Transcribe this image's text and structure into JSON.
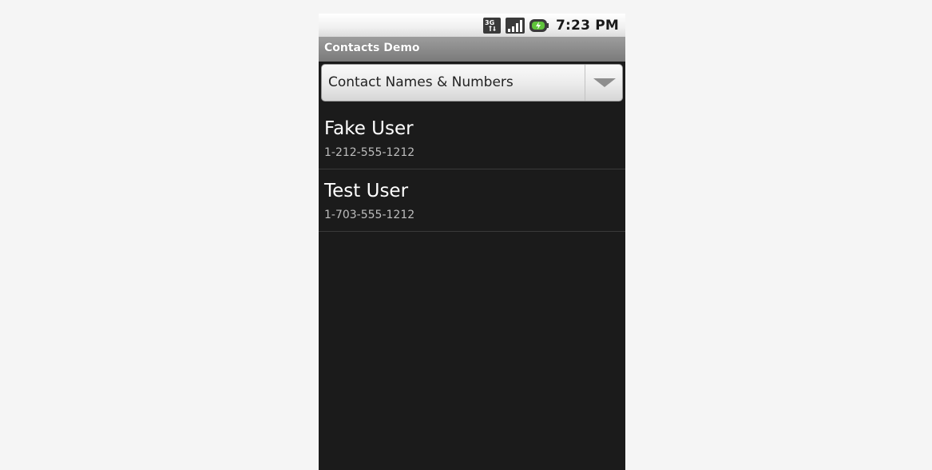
{
  "status_bar": {
    "network_icon": "3g-data-icon",
    "signal_icon": "signal-strength-icon",
    "battery_icon": "battery-charging-icon",
    "time": "7:23 PM"
  },
  "title_bar": {
    "title": "Contacts Demo"
  },
  "spinner": {
    "selected": "Contact Names & Numbers",
    "arrow_icon": "dropdown-arrow-icon"
  },
  "contacts": [
    {
      "name": "Fake User",
      "number": "1-212-555-1212"
    },
    {
      "name": "Test User",
      "number": "1-703-555-1212"
    }
  ],
  "colors": {
    "list_background": "#1b1b1b",
    "title_bar": "#8a8a8a",
    "name_text": "#ffffff",
    "number_text": "#bdbdbd"
  }
}
